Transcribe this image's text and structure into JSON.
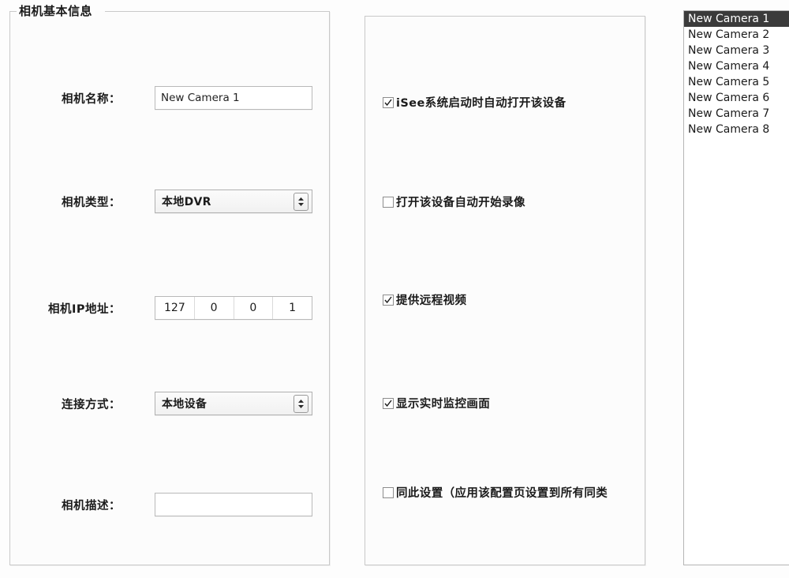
{
  "basic_info": {
    "group_title": "相机基本信息",
    "fields": [
      {
        "label": "相机名称：",
        "type": "text",
        "value": "New Camera 1",
        "placeholder": ""
      },
      {
        "label": "相机类型：",
        "type": "combo",
        "value": "本地DVR",
        "icon": "updown-arrow-icon"
      },
      {
        "label": "相机IP地址：",
        "type": "ip",
        "octets": [
          "127",
          "0",
          "0",
          "1"
        ]
      },
      {
        "label": "连接方式：",
        "type": "combo",
        "value": "本地设备",
        "icon": "updown-arrow-icon"
      },
      {
        "label": "相机描述：",
        "type": "text",
        "value": "",
        "placeholder": ""
      }
    ]
  },
  "options": {
    "checkboxes": [
      {
        "label": "iSee系统启动时自动打开该设备",
        "checked": true
      },
      {
        "label": "打开该设备自动开始录像",
        "checked": false
      },
      {
        "label": "提供远程视频",
        "checked": true
      },
      {
        "label": "显示实时监控画面",
        "checked": true
      },
      {
        "label": "同此设置（应用该配置页设置到所有同类",
        "checked": false
      }
    ]
  },
  "camera_list": {
    "items": [
      {
        "label": "New Camera 1",
        "selected": true
      },
      {
        "label": "New Camera 2",
        "selected": false
      },
      {
        "label": "New Camera 3",
        "selected": false
      },
      {
        "label": "New Camera 4",
        "selected": false
      },
      {
        "label": "New Camera 5",
        "selected": false
      },
      {
        "label": "New Camera 6",
        "selected": false
      },
      {
        "label": "New Camera 7",
        "selected": false
      },
      {
        "label": "New Camera 8",
        "selected": false
      }
    ]
  },
  "colors": {
    "panel_border": "#c9c9c9",
    "input_border": "#b9b9b9",
    "selection_bg": "#3b3b3b",
    "selection_fg": "#ffffff",
    "page_bg": "#fdfdfd"
  }
}
